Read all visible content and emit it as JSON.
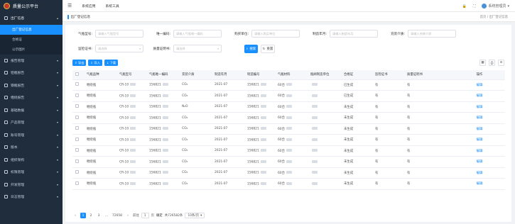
{
  "app": {
    "title": "质量公示平台"
  },
  "sidebar": {
    "items": [
      {
        "label": "出厂信息",
        "open": true,
        "children": [
          {
            "label": "出厂登记信息",
            "active": true
          },
          {
            "label": "合格证"
          },
          {
            "label": "公示图片"
          }
        ]
      },
      {
        "label": "报告管理"
      },
      {
        "label": "铝瓶报告"
      },
      {
        "label": "钢瓶报告"
      },
      {
        "label": "缠绕报告"
      },
      {
        "label": "基础数据"
      },
      {
        "label": "产品管理"
      },
      {
        "label": "账号管理"
      },
      {
        "label": "版本"
      },
      {
        "label": "组织架构"
      },
      {
        "label": "权限管理"
      },
      {
        "label": "开发管理"
      },
      {
        "label": "日志管理"
      }
    ]
  },
  "topbar": {
    "menu_icon": "hamburger-icon",
    "links": [
      "系统应用",
      "系统工具"
    ],
    "user_label": "系统管理员"
  },
  "tabbar": {
    "active_tab": "出厂登记信息",
    "breadcrumb": "首页 / 出厂登记信息"
  },
  "filters": {
    "row1": [
      {
        "label": "气瓶型号:",
        "placeholder": "请输入气瓶型号"
      },
      {
        "label": "唯一编码:",
        "placeholder": "请输入气瓶唯一编码"
      },
      {
        "label": "购买单位:",
        "placeholder": "请输入购买单位"
      },
      {
        "label": "制造年月:",
        "placeholder": "请输入制造年月"
      },
      {
        "label": "充装介质:",
        "placeholder": "请输入充装介质"
      }
    ],
    "row2": [
      {
        "label": "监检证书:",
        "placeholder": "请选择"
      },
      {
        "label": "质量证明书:",
        "placeholder": "请选择"
      }
    ],
    "search_label": "搜索",
    "reset_label": "重置"
  },
  "actions": {
    "export": "导出",
    "import": "导入",
    "download": "下载"
  },
  "table": {
    "columns": [
      "气瓶品种",
      "气瓶型号",
      "气瓶唯一编码",
      "充装介质",
      "制造年月",
      "制造编号",
      "气瓶材料",
      "瓶阀制造单位",
      "合格证",
      "监检证书",
      "质量证明书",
      "操作"
    ],
    "rows": [
      [
        "缠绕瓶",
        "CR-10",
        "156821",
        "CO₂",
        "2021-07",
        "156821",
        "60合",
        "",
        "已生成",
        "有",
        "有",
        "编辑"
      ],
      [
        "缠绕瓶",
        "CR-10",
        "156821",
        "CO₂",
        "2021-07",
        "156821",
        "60合",
        "",
        "已生成",
        "有",
        "有",
        "编辑"
      ],
      [
        "缠绕瓶",
        "CR-10",
        "156821",
        "N₂O",
        "2021-07",
        "156821",
        "60合",
        "",
        "未生成",
        "有",
        "有",
        "编辑"
      ],
      [
        "缠绕瓶",
        "CR-10",
        "156821",
        "CO₂",
        "2021-07",
        "156821",
        "60合",
        "",
        "未生成",
        "有",
        "有",
        "编辑"
      ],
      [
        "缠绕瓶",
        "CR-10",
        "156821",
        "CO₂",
        "2021-07",
        "156821",
        "60合",
        "",
        "未生成",
        "有",
        "有",
        "编辑"
      ],
      [
        "缠绕瓶",
        "CR-10",
        "156821",
        "CO₂",
        "2021-07",
        "156821",
        "60合",
        "",
        "未生成",
        "有",
        "有",
        "编辑"
      ],
      [
        "缠绕瓶",
        "CR-10",
        "156821",
        "CO₂",
        "2021-07",
        "156821",
        "60合",
        "",
        "未生成",
        "有",
        "有",
        "编辑"
      ],
      [
        "缠绕瓶",
        "CR-10",
        "156821",
        "CO₂",
        "2021-07",
        "156821",
        "60合",
        "",
        "未生成",
        "有",
        "有",
        "编辑"
      ],
      [
        "缠绕瓶",
        "CR-10",
        "156821",
        "CO₂",
        "2021-07",
        "156821",
        "60合",
        "",
        "未生成",
        "有",
        "有",
        "编辑"
      ],
      [
        "缠绕瓶",
        "CR-10",
        "156821",
        "CO₂",
        "2021-07",
        "156821",
        "60合",
        "",
        "未生成",
        "有",
        "有",
        "编辑"
      ]
    ]
  },
  "pager": {
    "pages": [
      "1",
      "2",
      "3",
      "...",
      "72658"
    ],
    "current": "1",
    "goto_label": "前往",
    "goto_value": "1",
    "goto_suffix": "页",
    "confirm": "确定",
    "total": "共726582条",
    "page_size": "10条/页"
  }
}
